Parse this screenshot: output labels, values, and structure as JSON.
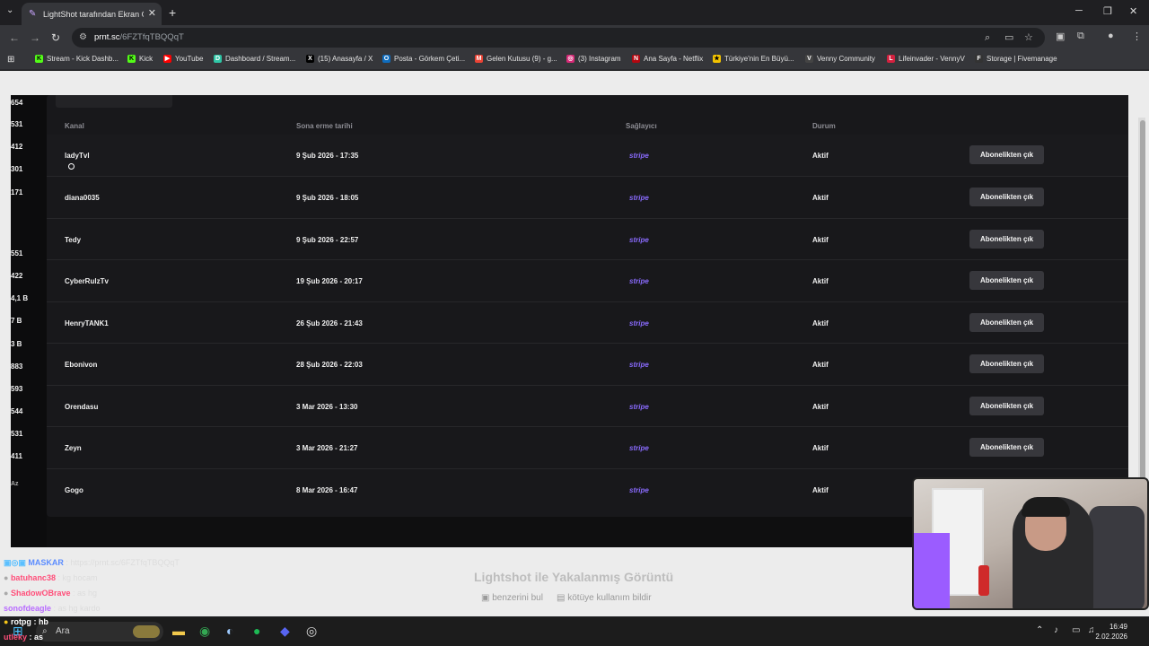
{
  "browser": {
    "tab_title": "LightShot tarafından Ekran Görü",
    "tab_close": "✕",
    "new_tab": "+",
    "url_host": "prnt.sc",
    "url_path": "/6FZTfqTBQQqT",
    "bookmarks": [
      {
        "label": "Stream - Kick Dashb...",
        "icon": "kick-icon",
        "color": "#53fc18",
        "glyph": "K"
      },
      {
        "label": "Kick",
        "icon": "kick-icon",
        "color": "#53fc18",
        "glyph": "K"
      },
      {
        "label": "YouTube",
        "icon": "youtube-icon",
        "color": "#ff0000",
        "glyph": "▶"
      },
      {
        "label": "Dashboard / Stream...",
        "icon": "dashboard-icon",
        "color": "#2fc6a6",
        "glyph": "D"
      },
      {
        "label": "(15) Anasayfa / X",
        "icon": "x-icon",
        "color": "#000000",
        "glyph": "X"
      },
      {
        "label": "Posta - Görkem Çeti...",
        "icon": "outlook-icon",
        "color": "#0f6cbd",
        "glyph": "O"
      },
      {
        "label": "Gelen Kutusu (9) - g...",
        "icon": "gmail-icon",
        "color": "#ea4335",
        "glyph": "M"
      },
      {
        "label": "(3) Instagram",
        "icon": "instagram-icon",
        "color": "#d62976",
        "glyph": "◎"
      },
      {
        "label": "Ana Sayfa - Netflix",
        "icon": "netflix-icon",
        "color": "#b20710",
        "glyph": "N"
      },
      {
        "label": "Türkiye'nin En Büyü...",
        "icon": "sahibinden-icon",
        "color": "#f4c400",
        "glyph": "★"
      },
      {
        "label": "Venny Community",
        "icon": "venny-icon",
        "color": "#444444",
        "glyph": "V"
      },
      {
        "label": "Lifeinvader - VennyV",
        "icon": "lifeinvader-icon",
        "color": "#d3213f",
        "glyph": "L"
      },
      {
        "label": "Storage | Fivemanage",
        "icon": "fivemanage-icon",
        "color": "#333333",
        "glyph": "F"
      }
    ]
  },
  "left_numbers": [
    "654",
    "531",
    "412",
    "301",
    "171",
    "551",
    "422",
    "4,1 B",
    "7 B",
    "3 B",
    "883",
    "593",
    "544",
    "531",
    "411",
    "Az"
  ],
  "table": {
    "headers": {
      "channel": "Kanal",
      "expiry": "Sona erme tarihi",
      "provider": "Sağlayıcı",
      "status": "Durum"
    },
    "rows": [
      {
        "channel": "ladyTvl",
        "expiry": "9 Şub 2026 - 17:35",
        "provider": "stripe",
        "status": "Aktif",
        "action": "Abonelikten çık"
      },
      {
        "channel": "diana0035",
        "expiry": "9 Şub 2026 - 18:05",
        "provider": "stripe",
        "status": "Aktif",
        "action": "Abonelikten çık"
      },
      {
        "channel": "Tedy",
        "expiry": "9 Şub 2026 - 22:57",
        "provider": "stripe",
        "status": "Aktif",
        "action": "Abonelikten çık"
      },
      {
        "channel": "CyberRulzTv",
        "expiry": "19 Şub 2026 - 20:17",
        "provider": "stripe",
        "status": "Aktif",
        "action": "Abonelikten çık"
      },
      {
        "channel": "HenryTANK1",
        "expiry": "26 Şub 2026 - 21:43",
        "provider": "stripe",
        "status": "Aktif",
        "action": "Abonelikten çık"
      },
      {
        "channel": "Ebonivon",
        "expiry": "28 Şub 2026 - 22:03",
        "provider": "stripe",
        "status": "Aktif",
        "action": "Abonelikten çık"
      },
      {
        "channel": "Orendasu",
        "expiry": "3 Mar 2026 - 13:30",
        "provider": "stripe",
        "status": "Aktif",
        "action": "Abonelikten çık"
      },
      {
        "channel": "Zeyn",
        "expiry": "3 Mar 2026 - 21:27",
        "provider": "stripe",
        "status": "Aktif",
        "action": "Abonelikten çık"
      },
      {
        "channel": "Gogo",
        "expiry": "8 Mar 2026 - 16:47",
        "provider": "stripe",
        "status": "Aktif",
        "action": ""
      }
    ]
  },
  "lightshot": {
    "title": "Lightshot ile Yakalanmış Görüntü",
    "find_similar": "benzerini bul",
    "report": "kötüye kullanım bildir"
  },
  "chat": [
    {
      "user": "MASKAR",
      "msg": "https://prnt.sc/6FZTfqTBQQqT",
      "color": "#5b8cff"
    },
    {
      "user": "batuhanc38",
      "msg": "kg hocam",
      "color": "#ff4f7a"
    },
    {
      "user": "ShadowOBrave",
      "msg": "as hg",
      "color": "#ff4f7a"
    },
    {
      "user": "sonofdeagle",
      "msg": "as hg kardo",
      "color": "#b86bff"
    },
    {
      "user": "rotpg",
      "msg": "hb",
      "color": "#ffffff"
    },
    {
      "user": "utleky",
      "msg": "as",
      "color": "#ff4f7a"
    }
  ],
  "taskbar": {
    "search": "Ara",
    "time": "16:49",
    "date": "2.02.2026"
  }
}
